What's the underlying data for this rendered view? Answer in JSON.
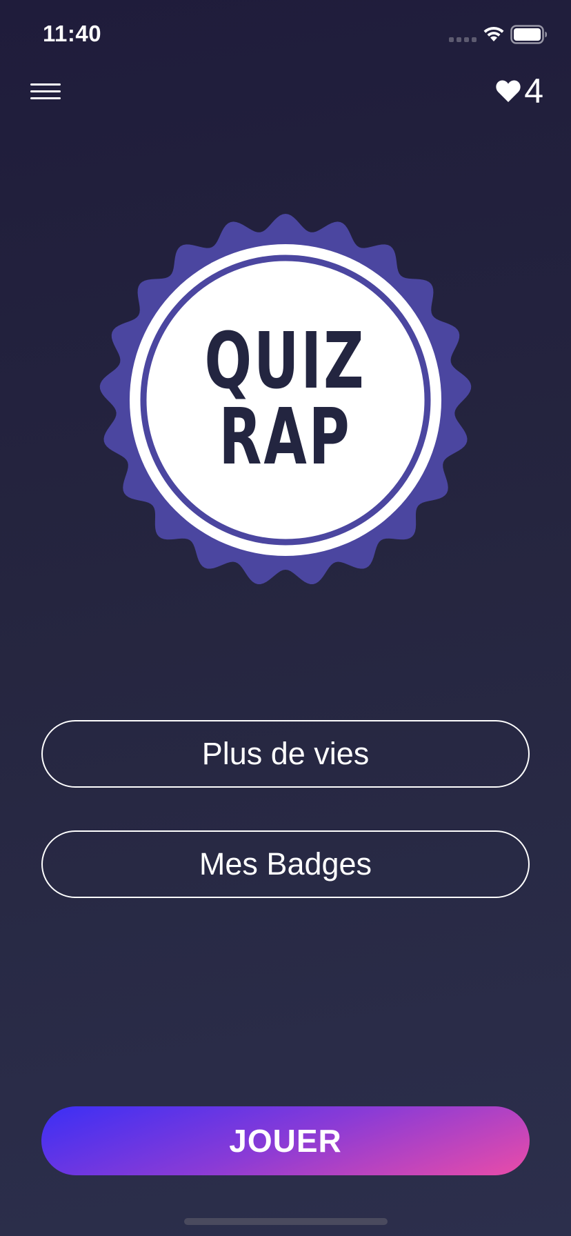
{
  "status_bar": {
    "time": "11:40",
    "icons": [
      "signal-icon",
      "wifi-icon",
      "battery-icon"
    ]
  },
  "header": {
    "menu_icon": "hamburger-menu-icon",
    "lives_icon": "heart-icon",
    "lives_count": "4"
  },
  "logo": {
    "line1": "QUIZ",
    "line2": "RAP",
    "badge_color": "#4b46a0",
    "text_color": "#232540"
  },
  "buttons": {
    "more_lives": "Plus de vies",
    "my_badges": "Mes Badges",
    "play": "JOUER"
  },
  "colors": {
    "background_top": "#1f1c3b",
    "background_bottom": "#2c2f4c",
    "play_gradient_start": "#3b2ff5",
    "play_gradient_end": "#ea4ca8"
  }
}
